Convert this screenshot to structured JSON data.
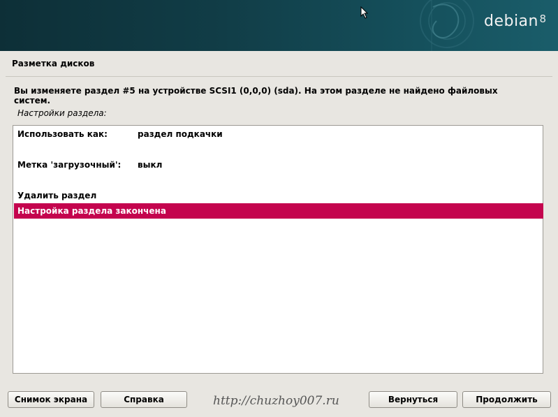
{
  "header": {
    "brand": "debian",
    "version": "8"
  },
  "page": {
    "title": "Разметка дисков",
    "description": "Вы изменяете раздел #5 на устройстве SCSI1 (0,0,0) (sda). На этом разделе не найдено файловых систем.",
    "section_label": "Настройки раздела:"
  },
  "options": {
    "use_as": {
      "label": "Использовать как:",
      "value": "раздел подкачки"
    },
    "bootable": {
      "label": "Метка 'загрузочный':",
      "value": "выкл"
    },
    "delete": {
      "label": "Удалить раздел"
    },
    "done": {
      "label": "Настройка раздела закончена"
    }
  },
  "buttons": {
    "screenshot": "Снимок экрана",
    "help": "Справка",
    "back": "Вернуться",
    "continue": "Продолжить"
  },
  "watermark": "http://chuzhoy007.ru",
  "colors": {
    "selection": "#c4044e",
    "header": "#113d47"
  }
}
